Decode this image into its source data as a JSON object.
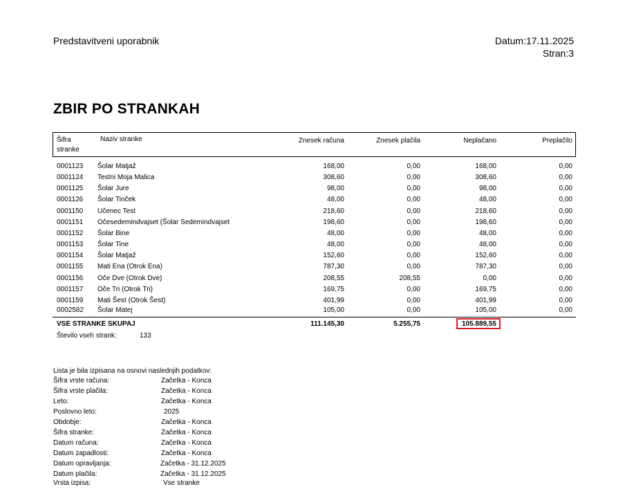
{
  "header": {
    "user": "Predstavitveni uporabnik",
    "date": "Datum:17.11.2025",
    "page": "Stran:3"
  },
  "title": "ZBIR PO STRANKAH",
  "table": {
    "columns": {
      "code_line1": "Šifra",
      "code_line2": "stranke",
      "name": "Naziv stranke",
      "invoice": "Znesek računa",
      "payment": "Znesek plačila",
      "unpaid": "Neplačano",
      "overpaid": "Preplačilo"
    },
    "rows": [
      {
        "code": "0001123",
        "name": "Šolar Matjaž",
        "invoice": "168,00",
        "payment": "0,00",
        "unpaid": "168,00",
        "overpaid": "0,00"
      },
      {
        "code": "0001124",
        "name": "Testni Moja Malica",
        "invoice": "308,60",
        "payment": "0,00",
        "unpaid": "308,60",
        "overpaid": "0,00"
      },
      {
        "code": "0001125",
        "name": "Šolar Jure",
        "invoice": "98,00",
        "payment": "0,00",
        "unpaid": "98,00",
        "overpaid": "0,00"
      },
      {
        "code": "0001126",
        "name": "Šolar Tinček",
        "invoice": "48,00",
        "payment": "0,00",
        "unpaid": "48,00",
        "overpaid": "0,00"
      },
      {
        "code": "0001150",
        "name": "Učenec Test",
        "invoice": "218,60",
        "payment": "0,00",
        "unpaid": "218,60",
        "overpaid": "0,00"
      },
      {
        "code": "0001151",
        "name": "Očesedemindvajset  (Šolar Sedemindvajset",
        "invoice": "198,60",
        "payment": "0,00",
        "unpaid": "198,60",
        "overpaid": "0,00"
      },
      {
        "code": "0001152",
        "name": "Šolar Bine",
        "invoice": "48,00",
        "payment": "0,00",
        "unpaid": "48,00",
        "overpaid": "0,00"
      },
      {
        "code": "0001153",
        "name": "Šolar Tine",
        "invoice": "48,00",
        "payment": "0,00",
        "unpaid": "48,00",
        "overpaid": "0,00"
      },
      {
        "code": "0001154",
        "name": "Šolar Matjaž",
        "invoice": "152,60",
        "payment": "0,00",
        "unpaid": "152,60",
        "overpaid": "0,00"
      },
      {
        "code": "0001155",
        "name": "Mati Ena (Otrok Ena)",
        "invoice": "787,30",
        "payment": "0,00",
        "unpaid": "787,30",
        "overpaid": "0,00"
      },
      {
        "code": "0001156",
        "name": "Oče Dve (Otrok Dve)",
        "invoice": "208,55",
        "payment": "208,55",
        "unpaid": "0,00",
        "overpaid": "0,00"
      },
      {
        "code": "0001157",
        "name": "Oče Tri (Otrok Tri)",
        "invoice": "169,75",
        "payment": "0,00",
        "unpaid": "169,75",
        "overpaid": "0,00"
      },
      {
        "code": "0001159",
        "name": "Mati Šest (Otrok Šest)",
        "invoice": "401,99",
        "payment": "0,00",
        "unpaid": "401,99",
        "overpaid": "0,00"
      },
      {
        "code": "0002582",
        "name": "Šolar Matej",
        "invoice": "105,00",
        "payment": "0,00",
        "unpaid": "105,00",
        "overpaid": "0,00"
      }
    ],
    "totals": {
      "label": "VSE STRANKE SKUPAJ",
      "invoice": "111.145,30",
      "payment": "5.255,75",
      "unpaid": "105.889,55"
    },
    "count_label": "Število vseh strank:",
    "count_value": "133"
  },
  "criteria": {
    "intro": "Lista je bila izpisana na osnovi naslednjih podatkov:",
    "items": [
      {
        "label": "Šifra vrste računa:",
        "value": "Začetka - Konca"
      },
      {
        "label": "Šifra vrste plačila:",
        "value": "Začetka - Konca"
      },
      {
        "label": "Leto:",
        "value": "Začetka - Konca"
      },
      {
        "label": "Poslovno leto:",
        "value": "2025"
      },
      {
        "label": "Obdobje:",
        "value": "Začetka - Konca"
      },
      {
        "label": "Šifra stranke:",
        "value": "Začetka - Konca"
      },
      {
        "label": "Datum računa:",
        "value": "Začetka - Konca"
      },
      {
        "label": "Datum zapadlosti:",
        "value": "Začetka - Konca"
      },
      {
        "label": "Datum opravljanja:",
        "value": "Začetka - 31.12.2025"
      },
      {
        "label": "Datum plačila:",
        "value": "Začetka - 31.12.2025"
      },
      {
        "label": "Vrsta izpisa:",
        "value": "Vse stranke"
      }
    ]
  },
  "highlight_color": "#d81b24"
}
